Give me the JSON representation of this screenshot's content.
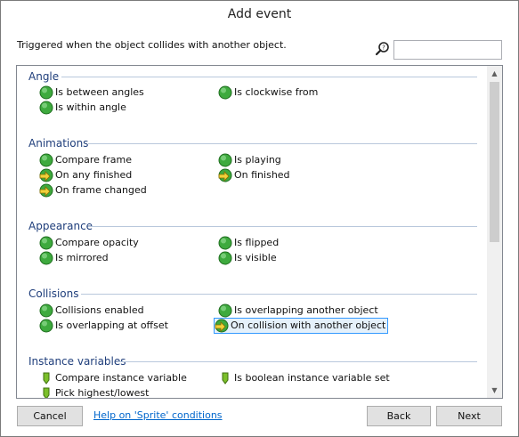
{
  "window": {
    "title": "Add event"
  },
  "description": "Triggered when the object collides with another object.",
  "search": {
    "value": "",
    "placeholder": ""
  },
  "groups": [
    {
      "name": "Angle",
      "items": [
        {
          "label": "Is between angles",
          "icon": "green-circle-icon"
        },
        {
          "label": "Is clockwise from",
          "icon": "green-circle-icon"
        },
        {
          "label": "Is within angle",
          "icon": "green-circle-icon"
        }
      ]
    },
    {
      "name": "Animations",
      "items": [
        {
          "label": "Compare frame",
          "icon": "green-circle-icon"
        },
        {
          "label": "Is playing",
          "icon": "green-circle-icon"
        },
        {
          "label": "On any finished",
          "icon": "trigger-arrow-icon"
        },
        {
          "label": "On finished",
          "icon": "trigger-arrow-icon"
        },
        {
          "label": "On frame changed",
          "icon": "trigger-arrow-icon"
        }
      ]
    },
    {
      "name": "Appearance",
      "items": [
        {
          "label": "Compare opacity",
          "icon": "green-circle-icon"
        },
        {
          "label": "Is flipped",
          "icon": "green-circle-icon"
        },
        {
          "label": "Is mirrored",
          "icon": "green-circle-icon"
        },
        {
          "label": "Is visible",
          "icon": "green-circle-icon"
        }
      ]
    },
    {
      "name": "Collisions",
      "items": [
        {
          "label": "Collisions enabled",
          "icon": "green-circle-icon"
        },
        {
          "label": "Is overlapping another object",
          "icon": "green-circle-icon"
        },
        {
          "label": "Is overlapping at offset",
          "icon": "green-circle-icon"
        },
        {
          "label": "On collision with another object",
          "icon": "trigger-arrow-icon",
          "selected": true
        }
      ]
    },
    {
      "name": "Instance variables",
      "items": [
        {
          "label": "Compare instance variable",
          "icon": "green-flag-icon"
        },
        {
          "label": "Is boolean instance variable set",
          "icon": "green-flag-icon"
        },
        {
          "label": "Pick highest/lowest",
          "icon": "green-flag-icon"
        }
      ]
    }
  ],
  "footer": {
    "cancel": "Cancel",
    "help": "Help on 'Sprite' conditions",
    "back": "Back",
    "next": "Next"
  },
  "colors": {
    "group_header": "#1f3e7b",
    "link": "#0066cc",
    "selection": "#e5f1fb",
    "selection_border": "#3399ff"
  }
}
